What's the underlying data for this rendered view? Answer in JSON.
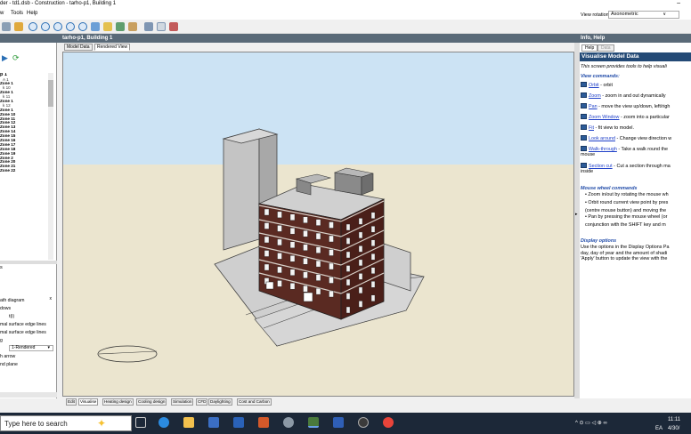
{
  "window": {
    "title": "der - td1.dsb - Construction - tarho-p1, Building 1",
    "minimize": "–"
  },
  "menu": {
    "items": [
      "w",
      "Tools",
      "Help"
    ],
    "view_rotation_label": "View rotation",
    "view_rotation_value": "Axonometric",
    "view_rotation_arrow": "∨"
  },
  "header": {
    "title": "tarho-p1, Building 1",
    "info_title": "Info, Help"
  },
  "view_tabs": [
    "Model Data",
    "Rendered View"
  ],
  "tree": {
    "rows": [
      {
        "t": "p 1",
        "b": true
      },
      {
        "t": "A 1",
        "b": false
      },
      {
        "t": "Zone 1",
        "b": true
      },
      {
        "t": "k 10",
        "b": false
      },
      {
        "t": "Zone 1",
        "b": true
      },
      {
        "t": "k 11",
        "b": false
      },
      {
        "t": "Zone 1",
        "b": true
      },
      {
        "t": "k 12",
        "b": false
      },
      {
        "t": "Zone 1",
        "b": true
      },
      {
        "t": "Zone 10",
        "b": true
      },
      {
        "t": "Zone 11",
        "b": true
      },
      {
        "t": "Zone 12",
        "b": true
      },
      {
        "t": "Zone 13",
        "b": true
      },
      {
        "t": "Zone 14",
        "b": true
      },
      {
        "t": "Zone 15",
        "b": true
      },
      {
        "t": "Zone 16",
        "b": true
      },
      {
        "t": "Zone 17",
        "b": true
      },
      {
        "t": "Zone 18",
        "b": true
      },
      {
        "t": "Zone 19",
        "b": true
      },
      {
        "t": "Zone 2",
        "b": true
      },
      {
        "t": "Zone 20",
        "b": true
      },
      {
        "t": "Zone 21",
        "b": true
      },
      {
        "t": "Zone 22",
        "b": true
      }
    ]
  },
  "left_panel": {
    "section_label": "s",
    "options": [
      "ath diagram",
      "dows",
      "t(i)",
      "mal surface edge lines",
      "mal surface edge lines",
      "g",
      "",
      "h arrow",
      "nd plane"
    ],
    "render_select": "1-Rendered",
    "close_x": "x"
  },
  "bottom_tabs": [
    "Edit",
    "Visualise",
    "Heating design",
    "Cooling design",
    "Simulation",
    "CFD",
    "Daylighting",
    "Cost and Carbon"
  ],
  "bottom_active": "Visualise",
  "help": {
    "tabs": [
      "Help",
      "Data"
    ],
    "title": "Visualise Model Data",
    "intro": "This screen provides tools to help visuali",
    "view_commands_head": "View commands:",
    "commands": [
      {
        "link": "Orbit",
        "rest": " - orbit"
      },
      {
        "link": "Zoom",
        "rest": " - zoom in and out dynamically"
      },
      {
        "link": "Pan",
        "rest": " - move the view up/down, left/righ"
      },
      {
        "link": "Zoom Window",
        "rest": " - zoom into a particular"
      },
      {
        "link": "Fit",
        "rest": " - fit view to model."
      },
      {
        "link": "Look around",
        "rest": " - Change view direction w"
      },
      {
        "link": "Walk-through",
        "rest": " - Take a walk round the"
      },
      {
        "link": "",
        "rest": "mouse"
      },
      {
        "link": "Section cut",
        "rest": " - Cut a section through ma"
      },
      {
        "link": "",
        "rest": "inside"
      }
    ],
    "wheel_head": "Mouse wheel commands",
    "wheel": [
      "• Zoom in/out by rotating the mouse wh",
      "• Orbit round current view point by pres",
      "  (centre mouse button) and moving the",
      "• Pan by pressing the mouse wheel (or",
      "  conjunction with the SHIFT key and m"
    ],
    "display_head": "Display options",
    "display": [
      "Use the options in the Display Options Pa",
      "day, day of year and the amount of shadi",
      "'Apply' button to update the view with the"
    ]
  },
  "taskbar": {
    "search_placeholder": "Type here to search",
    "time": "11:11",
    "date": "4/30/",
    "lang": "EA"
  },
  "colors": {
    "sky": "#cce3f4",
    "ground": "#ebe5cf",
    "brick": "#5a2a22",
    "concrete": "#cacaca",
    "accent_panel": "#244a76"
  }
}
